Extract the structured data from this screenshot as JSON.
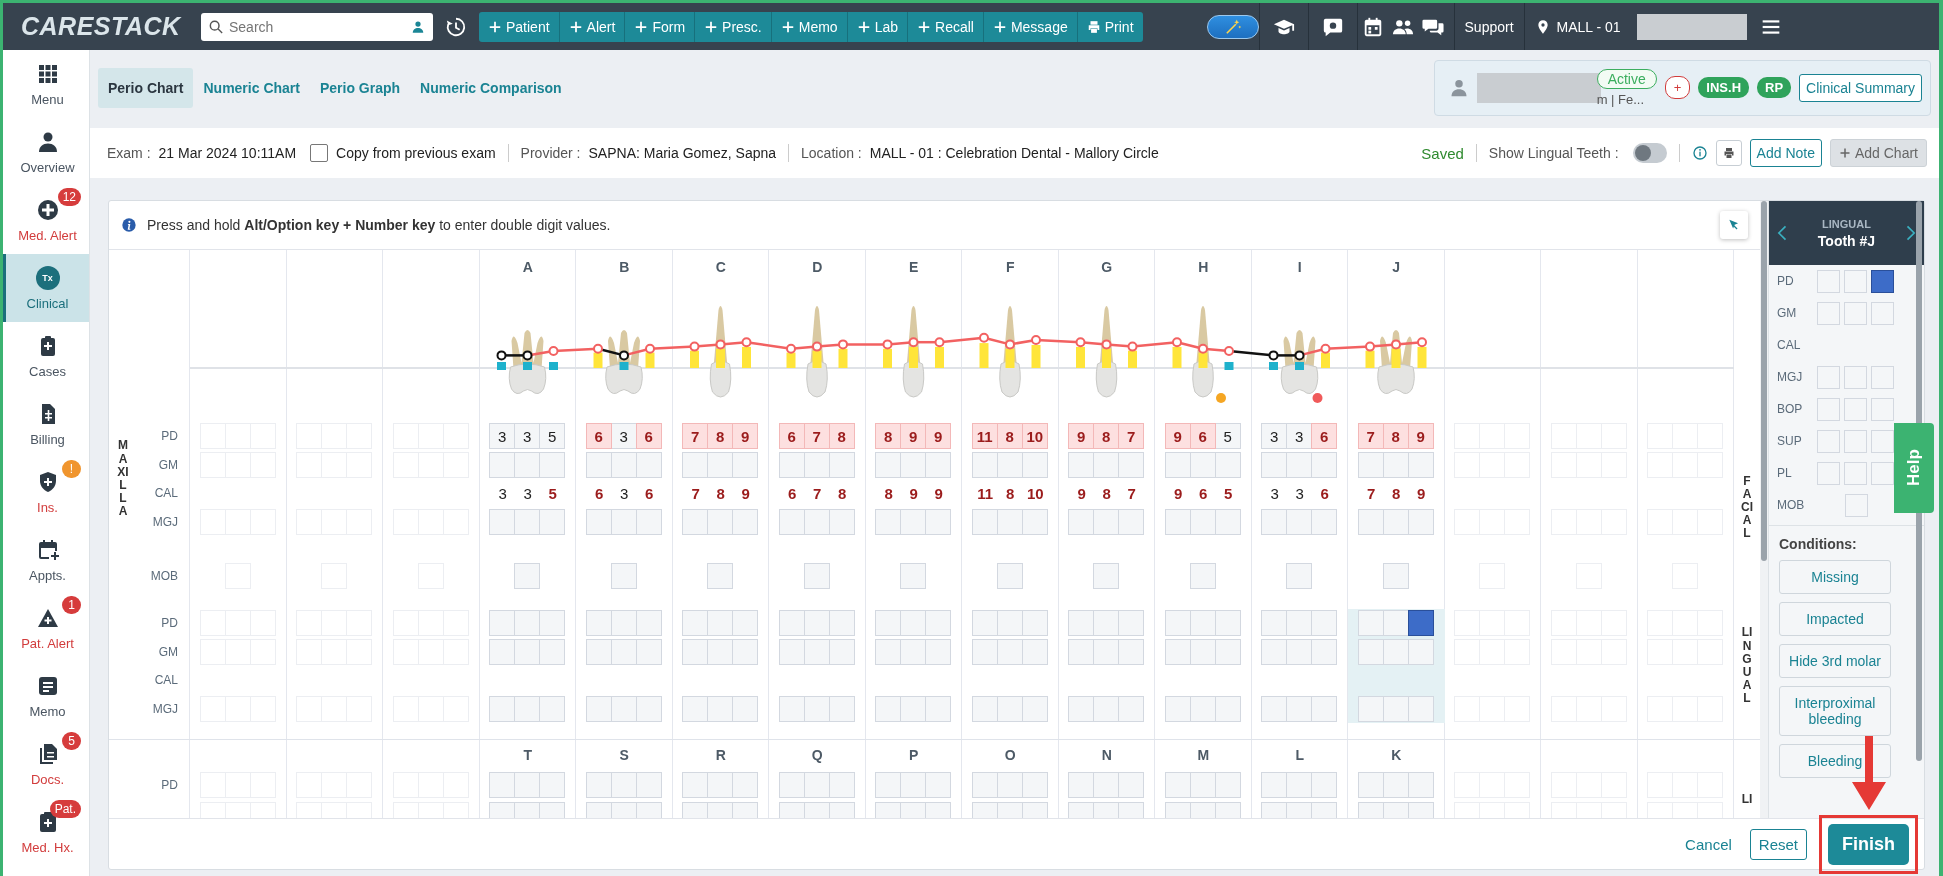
{
  "top_bar": {
    "logo": "CARESTACK",
    "search": {
      "placeholder": "Search"
    },
    "actions": [
      {
        "label": "Patient",
        "kind": "add"
      },
      {
        "label": "Alert",
        "kind": "add"
      },
      {
        "label": "Form",
        "kind": "add"
      },
      {
        "label": "Presc.",
        "kind": "add"
      },
      {
        "label": "Memo",
        "kind": "add"
      },
      {
        "label": "Lab",
        "kind": "add"
      },
      {
        "label": "Recall",
        "kind": "add"
      },
      {
        "label": "Message",
        "kind": "add"
      },
      {
        "label": "Print",
        "kind": "print"
      }
    ],
    "support": "Support",
    "location": "MALL - 01"
  },
  "sidebar": {
    "items": [
      {
        "label": "Menu",
        "selected": false,
        "alert": false
      },
      {
        "label": "Overview",
        "selected": false,
        "alert": false
      },
      {
        "label": "Med. Alert",
        "selected": false,
        "alert": true,
        "badge": {
          "text": "12",
          "color": "#d63c3c"
        }
      },
      {
        "label": "Clinical",
        "icon_text": "Tx",
        "selected": true,
        "alert": false
      },
      {
        "label": "Cases",
        "selected": false,
        "alert": false
      },
      {
        "label": "Billing",
        "selected": false,
        "alert": false
      },
      {
        "label": "Ins.",
        "selected": false,
        "alert": true,
        "badge": {
          "text": "!",
          "color": "#f0952e"
        }
      },
      {
        "label": "Appts.",
        "selected": false,
        "alert": false
      },
      {
        "label": "Pat. Alert",
        "selected": false,
        "alert": true,
        "badge": {
          "text": "1",
          "color": "#d63c3c"
        }
      },
      {
        "label": "Memo",
        "selected": false,
        "alert": false
      },
      {
        "label": "Docs.",
        "selected": false,
        "alert": true,
        "badge": {
          "text": "5",
          "color": "#d63c3c"
        }
      },
      {
        "label": "Med. Hx.",
        "selected": false,
        "alert": true,
        "badge": {
          "text": "Pat.",
          "color": "#d63c3c"
        }
      }
    ]
  },
  "tabs": [
    {
      "label": "Perio Chart",
      "selected": true
    },
    {
      "label": "Numeric Chart",
      "selected": false
    },
    {
      "label": "Perio Graph",
      "selected": false
    },
    {
      "label": "Numeric Comparison",
      "selected": false
    }
  ],
  "patient": {
    "status": "Active",
    "name_fragment": "m | Fe...",
    "tags": [
      {
        "label": "+",
        "kind": "outline"
      },
      {
        "label": "INS.H",
        "kind": "solid"
      },
      {
        "label": "RP",
        "kind": "solid"
      }
    ],
    "button": "Clinical Summary"
  },
  "exam": {
    "label": "Exam :",
    "date": "21 Mar 2024 10:11AM",
    "copy": {
      "label": "Copy from previous exam",
      "checked": false
    },
    "provider_label": "Provider :",
    "provider": "SAPNA: Maria Gomez, Sapna",
    "location_label": "Location :",
    "location": "MALL - 01 : Celebration Dental - Mallory Circle",
    "status": "Saved",
    "lingual": {
      "label": "Show Lingual Teeth :",
      "on": false
    },
    "add_note": "Add Note",
    "add_chart": "Add Chart"
  },
  "info": "Press and hold **Alt/Option key + Number key** to enter double digit values.",
  "chart": {
    "maxilla_label": "MAXILLA",
    "facial_label": "FACIAL",
    "lingual_label": "LINGUAL",
    "mandible_side_label": "LI",
    "facial_rows": [
      "PD",
      "GM",
      "CAL",
      "MGJ"
    ],
    "mob_label": "MOB",
    "lingual_rows": [
      "PD",
      "GM",
      "CAL",
      "MGJ"
    ],
    "mandible_rows": [
      "PD"
    ],
    "maxilla": [
      {
        "present": false
      },
      {
        "present": false
      },
      {
        "present": false
      },
      {
        "present": true,
        "letter": "A",
        "kind": "molar",
        "selected": false,
        "pd": [
          {
            "value": "3",
            "alert": false
          },
          {
            "value": "3",
            "alert": false
          },
          {
            "value": "5",
            "alert": false
          }
        ],
        "cal": [
          {
            "value": "3",
            "alert": false
          },
          {
            "value": "3",
            "alert": false
          },
          {
            "value": "5",
            "alert": true
          }
        ],
        "lingual_pd": [
          {
            "selected": false
          },
          {
            "selected": false
          },
          {
            "selected": false
          }
        ]
      },
      {
        "present": true,
        "letter": "B",
        "kind": "molar",
        "selected": false,
        "pd": [
          {
            "value": "6",
            "alert": true
          },
          {
            "value": "3",
            "alert": false
          },
          {
            "value": "6",
            "alert": true
          }
        ],
        "cal": [
          {
            "value": "6",
            "alert": true
          },
          {
            "value": "3",
            "alert": false
          },
          {
            "value": "6",
            "alert": true
          }
        ],
        "lingual_pd": [
          {
            "selected": false
          },
          {
            "selected": false
          },
          {
            "selected": false
          }
        ]
      },
      {
        "present": true,
        "letter": "C",
        "kind": "single",
        "selected": false,
        "pd": [
          {
            "value": "7",
            "alert": true
          },
          {
            "value": "8",
            "alert": true
          },
          {
            "value": "9",
            "alert": true
          }
        ],
        "cal": [
          {
            "value": "7",
            "alert": true
          },
          {
            "value": "8",
            "alert": true
          },
          {
            "value": "9",
            "alert": true
          }
        ],
        "lingual_pd": [
          {
            "selected": false
          },
          {
            "selected": false
          },
          {
            "selected": false
          }
        ]
      },
      {
        "present": true,
        "letter": "D",
        "kind": "single",
        "selected": false,
        "pd": [
          {
            "value": "6",
            "alert": true
          },
          {
            "value": "7",
            "alert": true
          },
          {
            "value": "8",
            "alert": true
          }
        ],
        "cal": [
          {
            "value": "6",
            "alert": true
          },
          {
            "value": "7",
            "alert": true
          },
          {
            "value": "8",
            "alert": true
          }
        ],
        "lingual_pd": [
          {
            "selected": false
          },
          {
            "selected": false
          },
          {
            "selected": false
          }
        ]
      },
      {
        "present": true,
        "letter": "E",
        "kind": "single",
        "selected": false,
        "pd": [
          {
            "value": "8",
            "alert": true
          },
          {
            "value": "9",
            "alert": true
          },
          {
            "value": "9",
            "alert": true
          }
        ],
        "cal": [
          {
            "value": "8",
            "alert": true
          },
          {
            "value": "9",
            "alert": true
          },
          {
            "value": "9",
            "alert": true
          }
        ],
        "lingual_pd": [
          {
            "selected": false
          },
          {
            "selected": false
          },
          {
            "selected": false
          }
        ]
      },
      {
        "present": true,
        "letter": "F",
        "kind": "single",
        "selected": false,
        "pd": [
          {
            "value": "11",
            "alert": true
          },
          {
            "value": "8",
            "alert": true
          },
          {
            "value": "10",
            "alert": true
          }
        ],
        "cal": [
          {
            "value": "11",
            "alert": true
          },
          {
            "value": "8",
            "alert": true
          },
          {
            "value": "10",
            "alert": true
          }
        ],
        "lingual_pd": [
          {
            "selected": false
          },
          {
            "selected": false
          },
          {
            "selected": false
          }
        ]
      },
      {
        "present": true,
        "letter": "G",
        "kind": "single",
        "selected": false,
        "pd": [
          {
            "value": "9",
            "alert": true
          },
          {
            "value": "8",
            "alert": true
          },
          {
            "value": "7",
            "alert": true
          }
        ],
        "cal": [
          {
            "value": "9",
            "alert": true
          },
          {
            "value": "8",
            "alert": true
          },
          {
            "value": "7",
            "alert": true
          }
        ],
        "lingual_pd": [
          {
            "selected": false
          },
          {
            "selected": false
          },
          {
            "selected": false
          }
        ]
      },
      {
        "present": true,
        "letter": "H",
        "kind": "single",
        "selected": false,
        "dot": {
          "color": "#f5a623"
        },
        "pd": [
          {
            "value": "9",
            "alert": true
          },
          {
            "value": "6",
            "alert": true
          },
          {
            "value": "5",
            "alert": false
          }
        ],
        "cal": [
          {
            "value": "9",
            "alert": true
          },
          {
            "value": "6",
            "alert": true
          },
          {
            "value": "5",
            "alert": true
          }
        ],
        "lingual_pd": [
          {
            "selected": false
          },
          {
            "selected": false
          },
          {
            "selected": false
          }
        ]
      },
      {
        "present": true,
        "letter": "I",
        "kind": "molar",
        "selected": false,
        "dot": {
          "color": "#f05a5a"
        },
        "pd": [
          {
            "value": "3",
            "alert": false
          },
          {
            "value": "3",
            "alert": false
          },
          {
            "value": "6",
            "alert": true
          }
        ],
        "cal": [
          {
            "value": "3",
            "alert": false
          },
          {
            "value": "3",
            "alert": false
          },
          {
            "value": "6",
            "alert": true
          }
        ],
        "lingual_pd": [
          {
            "selected": false
          },
          {
            "selected": false
          },
          {
            "selected": false
          }
        ]
      },
      {
        "present": true,
        "letter": "J",
        "kind": "molar",
        "selected": true,
        "pd": [
          {
            "value": "7",
            "alert": true
          },
          {
            "value": "8",
            "alert": true
          },
          {
            "value": "9",
            "alert": true
          }
        ],
        "cal": [
          {
            "value": "7",
            "alert": true
          },
          {
            "value": "8",
            "alert": true
          },
          {
            "value": "9",
            "alert": true
          }
        ],
        "lingual_pd": [
          {
            "selected": false
          },
          {
            "selected": false
          },
          {
            "selected": true
          }
        ]
      },
      {
        "present": false
      },
      {
        "present": false
      },
      {
        "present": false
      }
    ],
    "mandible": [
      {
        "present": false
      },
      {
        "present": false
      },
      {
        "present": false
      },
      {
        "present": true,
        "letter": "T"
      },
      {
        "present": true,
        "letter": "S"
      },
      {
        "present": true,
        "letter": "R"
      },
      {
        "present": true,
        "letter": "Q"
      },
      {
        "present": true,
        "letter": "P"
      },
      {
        "present": true,
        "letter": "O"
      },
      {
        "present": true,
        "letter": "N"
      },
      {
        "present": true,
        "letter": "M"
      },
      {
        "present": true,
        "letter": "L"
      },
      {
        "present": true,
        "letter": "K"
      },
      {
        "present": false
      },
      {
        "present": false
      },
      {
        "present": false
      }
    ]
  },
  "panel": {
    "surface": "LINGUAL",
    "tooth": "Tooth #J",
    "rows": [
      {
        "label": "PD",
        "boxes": [
          {
            "selected": false
          },
          {
            "selected": false
          },
          {
            "selected": true
          }
        ]
      },
      {
        "label": "GM",
        "boxes": [
          {
            "selected": false
          },
          {
            "selected": false
          },
          {
            "selected": false
          }
        ]
      },
      {
        "label": "CAL"
      },
      {
        "label": "MGJ",
        "boxes": [
          {
            "selected": false
          },
          {
            "selected": false
          },
          {
            "selected": false
          }
        ]
      },
      {
        "label": "BOP",
        "boxes": [
          {
            "selected": false
          },
          {
            "selected": false
          },
          {
            "selected": false
          }
        ]
      },
      {
        "label": "SUP",
        "boxes": [
          {
            "selected": false
          },
          {
            "selected": false
          },
          {
            "selected": false
          }
        ]
      },
      {
        "label": "PL",
        "boxes": [
          {
            "selected": false
          },
          {
            "selected": false
          },
          {
            "selected": false
          }
        ]
      },
      {
        "label": "MOB",
        "boxes": [
          {
            "selected": false
          }
        ]
      }
    ],
    "conditions_label": "Conditions:",
    "conditions": [
      "Missing",
      "Impacted",
      "Hide 3rd molar",
      "Interproximal bleeding",
      "Bleeding"
    ]
  },
  "help": "Help",
  "footer": {
    "cancel": "Cancel",
    "reset": "Reset",
    "finish": "Finish"
  }
}
